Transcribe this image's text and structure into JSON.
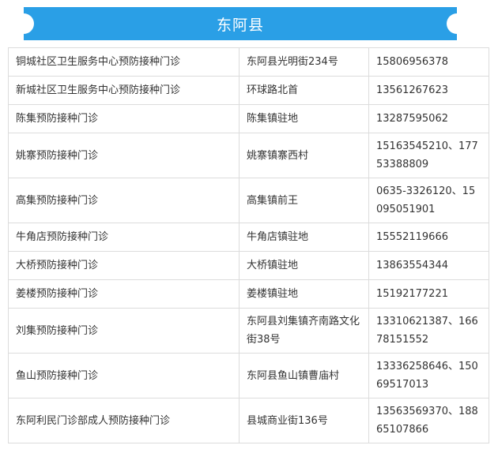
{
  "header": {
    "title": "东阿县"
  },
  "rows": [
    {
      "name": "铜城社区卫生服务中心预防接种门诊",
      "address": "东阿县光明街234号",
      "phone": "15806956378"
    },
    {
      "name": "新城社区卫生服务中心预防接种门诊",
      "address": "环球路北首",
      "phone": "13561267623"
    },
    {
      "name": "陈集预防接种门诊",
      "address": "陈集镇驻地",
      "phone": "13287595062"
    },
    {
      "name": "姚寨预防接种门诊",
      "address": "姚寨镇寨西村",
      "phone": "15163545210、17753388809"
    },
    {
      "name": "高集预防接种门诊",
      "address": "高集镇前王",
      "phone": "0635-3326120、15095051901"
    },
    {
      "name": "牛角店预防接种门诊",
      "address": "牛角店镇驻地",
      "phone": "15552119666"
    },
    {
      "name": "大桥预防接种门诊",
      "address": "大桥镇驻地",
      "phone": "13863554344"
    },
    {
      "name": "姜楼预防接种门诊",
      "address": "姜楼镇驻地",
      "phone": "15192177221"
    },
    {
      "name": "刘集预防接种门诊",
      "address": "东阿县刘集镇齐南路文化街38号",
      "phone": "13310621387、16678151552"
    },
    {
      "name": "鱼山预防接种门诊",
      "address": "东阿县鱼山镇曹庙村",
      "phone": "13336258646、15069517013"
    },
    {
      "name": "东阿利民门诊部成人预防接种门诊",
      "address": "县城商业街136号",
      "phone": "13563569370、18865107866"
    }
  ]
}
